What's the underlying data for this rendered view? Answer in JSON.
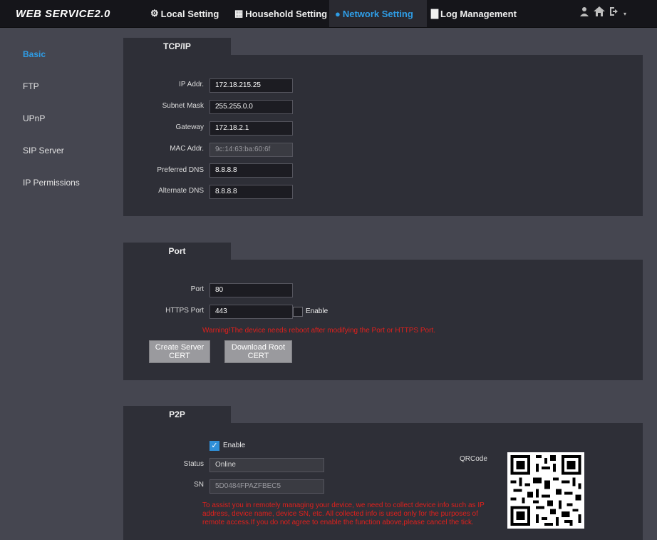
{
  "header": {
    "brand": "WEB SERVICE2.0",
    "nav": [
      {
        "label": "Local Setting",
        "icon": "gear-icon"
      },
      {
        "label": "Household Setting",
        "icon": "building-icon"
      },
      {
        "label": "Network Setting",
        "icon": "globe-icon"
      },
      {
        "label": "Log Management",
        "icon": "document-icon"
      }
    ],
    "icons": [
      "user-icon",
      "home-icon",
      "logout-icon"
    ]
  },
  "sidebar": {
    "items": [
      {
        "label": "Basic",
        "active": true
      },
      {
        "label": "FTP"
      },
      {
        "label": "UPnP"
      },
      {
        "label": "SIP Server"
      },
      {
        "label": "IP Permissions"
      }
    ]
  },
  "tcpip": {
    "tab": "TCP/IP",
    "fields": [
      {
        "label": "IP Addr.",
        "value": "172.18.215.25"
      },
      {
        "label": "Subnet Mask",
        "value": "255.255.0.0"
      },
      {
        "label": "Gateway",
        "value": "172.18.2.1"
      },
      {
        "label": "MAC Addr.",
        "value": "9c:14:63:ba:60:6f"
      },
      {
        "label": "Preferred DNS",
        "value": "8.8.8.8"
      },
      {
        "label": "Alternate DNS",
        "value": "8.8.8.8"
      }
    ]
  },
  "port": {
    "tab": "Port",
    "port_label": "Port",
    "port_value": "80",
    "https_label": "HTTPS Port",
    "https_value": "443",
    "enable_label": "Enable",
    "warning": "Warning!The device needs reboot after modifying the Port or HTTPS Port.",
    "create_cert": "Create Server CERT",
    "download_cert": "Download Root CERT"
  },
  "p2p": {
    "tab": "P2P",
    "enable_label": "Enable",
    "status_label": "Status",
    "status_value": "Online",
    "sn_label": "SN",
    "sn_value": "5D0484FPAZFBEC5",
    "qrcode_label": "QRCode",
    "notice": "To assist you in remotely managing your device, we need to collect device info such as IP address, device name, device SN, etc. All collected info is used only for the purposes of remote access.If you do not agree to enable the function above,please cancel the tick."
  },
  "colors": {
    "accent": "#2f9de6",
    "warning": "#e0201c",
    "panel": "#2e2f37",
    "background": "#454650"
  }
}
